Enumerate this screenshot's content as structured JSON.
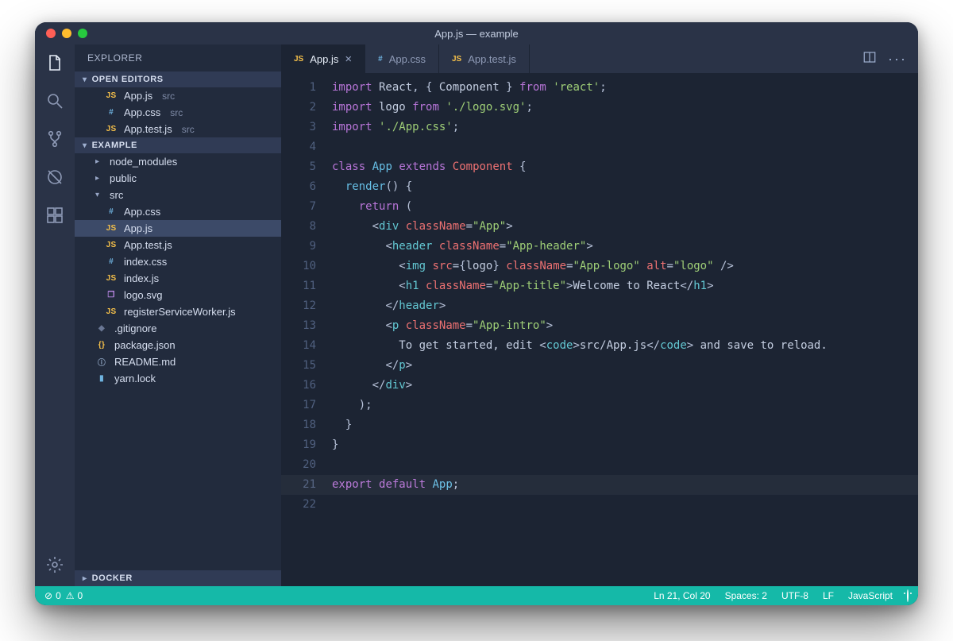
{
  "window": {
    "title": "App.js — example"
  },
  "sidebar": {
    "title": "EXPLORER",
    "openEditorsLabel": "OPEN EDITORS",
    "openEditors": [
      {
        "icon": "JS",
        "iconClass": "js",
        "name": "App.js",
        "dir": "src"
      },
      {
        "icon": "#",
        "iconClass": "hash",
        "name": "App.css",
        "dir": "src"
      },
      {
        "icon": "JS",
        "iconClass": "js",
        "name": "App.test.js",
        "dir": "src"
      }
    ],
    "projectLabel": "EXAMPLE",
    "tree": [
      {
        "type": "folder",
        "name": "node_modules",
        "expanded": false,
        "level": 0
      },
      {
        "type": "folder",
        "name": "public",
        "expanded": false,
        "level": 0
      },
      {
        "type": "folder",
        "name": "src",
        "expanded": true,
        "level": 0
      },
      {
        "type": "file",
        "icon": "#",
        "iconClass": "hash",
        "name": "App.css",
        "level": 1
      },
      {
        "type": "file",
        "icon": "JS",
        "iconClass": "js",
        "name": "App.js",
        "level": 1,
        "selected": true
      },
      {
        "type": "file",
        "icon": "JS",
        "iconClass": "js",
        "name": "App.test.js",
        "level": 1
      },
      {
        "type": "file",
        "icon": "#",
        "iconClass": "hash",
        "name": "index.css",
        "level": 1
      },
      {
        "type": "file",
        "icon": "JS",
        "iconClass": "js",
        "name": "index.js",
        "level": 1
      },
      {
        "type": "file",
        "icon": "❐",
        "iconClass": "svgico",
        "name": "logo.svg",
        "level": 1
      },
      {
        "type": "file",
        "icon": "JS",
        "iconClass": "js",
        "name": "registerServiceWorker.js",
        "level": 1
      },
      {
        "type": "file",
        "icon": "◆",
        "iconClass": "gitico",
        "name": ".gitignore",
        "level": 0
      },
      {
        "type": "file",
        "icon": "{}",
        "iconClass": "braces",
        "name": "package.json",
        "level": 0
      },
      {
        "type": "file",
        "icon": "ⓘ",
        "iconClass": "info",
        "name": "README.md",
        "level": 0
      },
      {
        "type": "file",
        "icon": "▮",
        "iconClass": "yarnico",
        "name": "yarn.lock",
        "level": 0
      }
    ],
    "dockerLabel": "DOCKER"
  },
  "tabs": [
    {
      "icon": "JS",
      "iconClass": "js",
      "label": "App.js",
      "active": true,
      "closable": true
    },
    {
      "icon": "#",
      "iconClass": "hash",
      "label": "App.css",
      "active": false
    },
    {
      "icon": "JS",
      "iconClass": "js",
      "label": "App.test.js",
      "active": false
    }
  ],
  "code": {
    "highlightLine": 21,
    "lines": [
      [
        [
          "kw",
          "import"
        ],
        [
          "txt",
          " React"
        ],
        [
          "punc",
          ", { "
        ],
        [
          "txt",
          "Component"
        ],
        [
          "punc",
          " } "
        ],
        [
          "kw",
          "from"
        ],
        [
          "txt",
          " "
        ],
        [
          "str",
          "'react'"
        ],
        [
          "punc",
          ";"
        ]
      ],
      [
        [
          "kw",
          "import"
        ],
        [
          "txt",
          " logo "
        ],
        [
          "kw",
          "from"
        ],
        [
          "txt",
          " "
        ],
        [
          "str",
          "'./logo.svg'"
        ],
        [
          "punc",
          ";"
        ]
      ],
      [
        [
          "kw",
          "import"
        ],
        [
          "txt",
          " "
        ],
        [
          "str",
          "'./App.css'"
        ],
        [
          "punc",
          ";"
        ]
      ],
      [],
      [
        [
          "kw",
          "class"
        ],
        [
          "txt",
          " "
        ],
        [
          "def",
          "App"
        ],
        [
          "txt",
          " "
        ],
        [
          "kw",
          "extends"
        ],
        [
          "txt",
          " "
        ],
        [
          "cls",
          "Component"
        ],
        [
          "txt",
          " "
        ],
        [
          "punc",
          "{"
        ]
      ],
      [
        [
          "txt",
          "  "
        ],
        [
          "fn",
          "render"
        ],
        [
          "punc",
          "() {"
        ]
      ],
      [
        [
          "txt",
          "    "
        ],
        [
          "kw",
          "return"
        ],
        [
          "txt",
          " "
        ],
        [
          "punc",
          "("
        ]
      ],
      [
        [
          "txt",
          "      "
        ],
        [
          "punc",
          "<"
        ],
        [
          "tag",
          "div"
        ],
        [
          "txt",
          " "
        ],
        [
          "attr",
          "className"
        ],
        [
          "punc",
          "="
        ],
        [
          "str",
          "\"App\""
        ],
        [
          "punc",
          ">"
        ]
      ],
      [
        [
          "txt",
          "        "
        ],
        [
          "punc",
          "<"
        ],
        [
          "tag",
          "header"
        ],
        [
          "txt",
          " "
        ],
        [
          "attr",
          "className"
        ],
        [
          "punc",
          "="
        ],
        [
          "str",
          "\"App-header\""
        ],
        [
          "punc",
          ">"
        ]
      ],
      [
        [
          "txt",
          "          "
        ],
        [
          "punc",
          "<"
        ],
        [
          "tag",
          "img"
        ],
        [
          "txt",
          " "
        ],
        [
          "attr",
          "src"
        ],
        [
          "punc",
          "={"
        ],
        [
          "txt",
          "logo"
        ],
        [
          "punc",
          "} "
        ],
        [
          "attr",
          "className"
        ],
        [
          "punc",
          "="
        ],
        [
          "str",
          "\"App-logo\""
        ],
        [
          "txt",
          " "
        ],
        [
          "attr",
          "alt"
        ],
        [
          "punc",
          "="
        ],
        [
          "str",
          "\"logo\""
        ],
        [
          "txt",
          " "
        ],
        [
          "punc",
          "/>"
        ]
      ],
      [
        [
          "txt",
          "          "
        ],
        [
          "punc",
          "<"
        ],
        [
          "tag",
          "h1"
        ],
        [
          "txt",
          " "
        ],
        [
          "attr",
          "className"
        ],
        [
          "punc",
          "="
        ],
        [
          "str",
          "\"App-title\""
        ],
        [
          "punc",
          ">"
        ],
        [
          "txt",
          "Welcome to React"
        ],
        [
          "punc",
          "</"
        ],
        [
          "tag",
          "h1"
        ],
        [
          "punc",
          ">"
        ]
      ],
      [
        [
          "txt",
          "        "
        ],
        [
          "punc",
          "</"
        ],
        [
          "tag",
          "header"
        ],
        [
          "punc",
          ">"
        ]
      ],
      [
        [
          "txt",
          "        "
        ],
        [
          "punc",
          "<"
        ],
        [
          "tag",
          "p"
        ],
        [
          "txt",
          " "
        ],
        [
          "attr",
          "className"
        ],
        [
          "punc",
          "="
        ],
        [
          "str",
          "\"App-intro\""
        ],
        [
          "punc",
          ">"
        ]
      ],
      [
        [
          "txt",
          "          To get started, edit "
        ],
        [
          "punc",
          "<"
        ],
        [
          "tag",
          "code"
        ],
        [
          "punc",
          ">"
        ],
        [
          "txt",
          "src/App.js"
        ],
        [
          "punc",
          "</"
        ],
        [
          "tag",
          "code"
        ],
        [
          "punc",
          ">"
        ],
        [
          "txt",
          " and save to reload."
        ]
      ],
      [
        [
          "txt",
          "        "
        ],
        [
          "punc",
          "</"
        ],
        [
          "tag",
          "p"
        ],
        [
          "punc",
          ">"
        ]
      ],
      [
        [
          "txt",
          "      "
        ],
        [
          "punc",
          "</"
        ],
        [
          "tag",
          "div"
        ],
        [
          "punc",
          ">"
        ]
      ],
      [
        [
          "txt",
          "    "
        ],
        [
          "punc",
          ");"
        ]
      ],
      [
        [
          "txt",
          "  "
        ],
        [
          "punc",
          "}"
        ]
      ],
      [
        [
          "punc",
          "}"
        ]
      ],
      [],
      [
        [
          "kw",
          "export"
        ],
        [
          "txt",
          " "
        ],
        [
          "kw",
          "default"
        ],
        [
          "txt",
          " "
        ],
        [
          "def",
          "App"
        ],
        [
          "punc",
          ";"
        ]
      ],
      []
    ]
  },
  "status": {
    "errors": "0",
    "warnings": "0",
    "cursor": "Ln 21, Col 20",
    "indent": "Spaces: 2",
    "encoding": "UTF-8",
    "eol": "LF",
    "language": "JavaScript"
  }
}
